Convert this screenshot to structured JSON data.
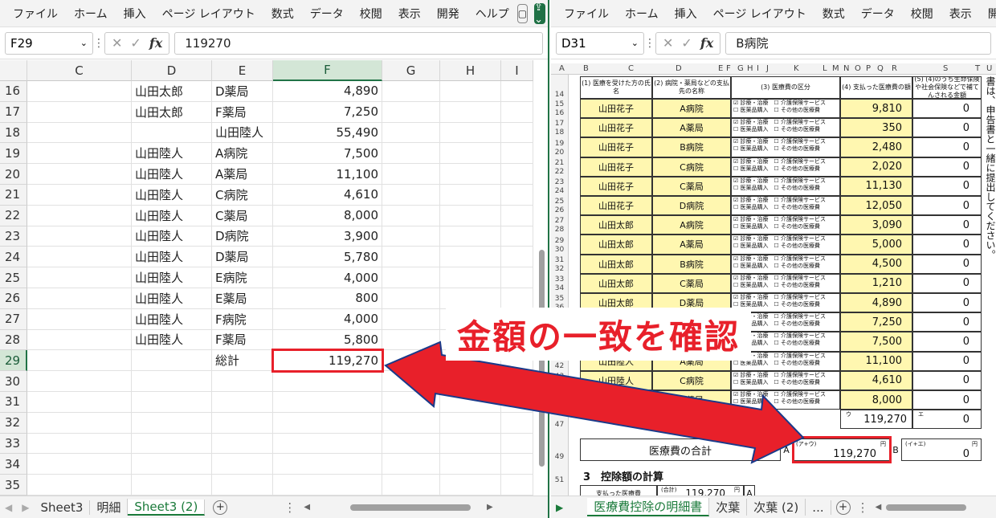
{
  "left": {
    "ribbon_tabs": [
      "ファイル",
      "ホーム",
      "挿入",
      "ページ レイアウト",
      "数式",
      "データ",
      "校閲",
      "表示",
      "開発",
      "ヘルプ"
    ],
    "comment_icon": "comment-icon",
    "share_icon": "share-icon",
    "namebox": "F29",
    "formula": "119270",
    "columns": [
      "C",
      "D",
      "E",
      "F",
      "G",
      "H",
      "I"
    ],
    "rows": [
      {
        "n": "16",
        "d": "山田太郎",
        "e": "D薬局",
        "f": "4,890"
      },
      {
        "n": "17",
        "d": "山田太郎",
        "e": "F薬局",
        "f": "7,250"
      },
      {
        "n": "18",
        "d": "",
        "e": "山田陸人",
        "f": "55,490"
      },
      {
        "n": "19",
        "d": "山田陸人",
        "e": "A病院",
        "f": "7,500"
      },
      {
        "n": "20",
        "d": "山田陸人",
        "e": "A薬局",
        "f": "11,100"
      },
      {
        "n": "21",
        "d": "山田陸人",
        "e": "C病院",
        "f": "4,610"
      },
      {
        "n": "22",
        "d": "山田陸人",
        "e": "C薬局",
        "f": "8,000"
      },
      {
        "n": "23",
        "d": "山田陸人",
        "e": "D病院",
        "f": "3,900"
      },
      {
        "n": "24",
        "d": "山田陸人",
        "e": "D薬局",
        "f": "5,780"
      },
      {
        "n": "25",
        "d": "山田陸人",
        "e": "E病院",
        "f": "4,000"
      },
      {
        "n": "26",
        "d": "山田陸人",
        "e": "E薬局",
        "f": "800"
      },
      {
        "n": "27",
        "d": "山田陸人",
        "e": "F病院",
        "f": "4,000"
      },
      {
        "n": "28",
        "d": "山田陸人",
        "e": "F薬局",
        "f": "5,800"
      },
      {
        "n": "29",
        "d": "",
        "e": "総計",
        "f": "119,270"
      },
      {
        "n": "30",
        "d": "",
        "e": "",
        "f": ""
      },
      {
        "n": "31",
        "d": "",
        "e": "",
        "f": ""
      },
      {
        "n": "32",
        "d": "",
        "e": "",
        "f": ""
      },
      {
        "n": "33",
        "d": "",
        "e": "",
        "f": ""
      },
      {
        "n": "34",
        "d": "",
        "e": "",
        "f": ""
      },
      {
        "n": "35",
        "d": "",
        "e": "",
        "f": ""
      }
    ],
    "sheet_tabs": [
      "Sheet3",
      "明細",
      "Sheet3 (2)"
    ]
  },
  "right": {
    "ribbon_tabs": [
      "ファイル",
      "ホーム",
      "挿入",
      "ページ レイアウト",
      "数式",
      "データ",
      "校閲",
      "表示",
      "開発",
      "ヘル"
    ],
    "namebox": "D31",
    "formula": "B病院",
    "columns": [
      "A",
      "B",
      "C",
      "D",
      "E",
      "F",
      "G",
      "H",
      "I",
      "J",
      "K",
      "L",
      "M",
      "N",
      "O",
      "P",
      "Q",
      "R",
      "S",
      "T",
      "U"
    ],
    "table_headers": [
      "(1) 医療を受けた方の氏名",
      "(2) 病院・薬局などの支払先の名称",
      "(3) 医療費の区分",
      "(4) 支払った医療費の額",
      "(5) (4)のうち生命保険や社会保険などで補てんされる金額"
    ],
    "category_labels": [
      "診療・治療",
      "介護保険サービス",
      "医薬品購入",
      "その他の医療費"
    ],
    "entries": [
      {
        "rows": "15\n16",
        "name": "山田花子",
        "place": "A病院",
        "amount": "9,810",
        "comp": "0",
        "unit": "円"
      },
      {
        "rows": "17\n18",
        "name": "山田花子",
        "place": "A薬局",
        "amount": "350",
        "comp": "0"
      },
      {
        "rows": "19\n20",
        "name": "山田花子",
        "place": "B病院",
        "amount": "2,480",
        "comp": "0"
      },
      {
        "rows": "21\n22",
        "name": "山田花子",
        "place": "C病院",
        "amount": "2,020",
        "comp": "0"
      },
      {
        "rows": "23\n24",
        "name": "山田花子",
        "place": "C薬局",
        "amount": "11,130",
        "comp": "0"
      },
      {
        "rows": "25\n26",
        "name": "山田花子",
        "place": "D病院",
        "amount": "12,050",
        "comp": "0"
      },
      {
        "rows": "27\n28",
        "name": "山田太郎",
        "place": "A病院",
        "amount": "3,090",
        "comp": "0"
      },
      {
        "rows": "29\n30",
        "name": "山田太郎",
        "place": "A薬局",
        "amount": "5,000",
        "comp": "0"
      },
      {
        "rows": "31\n32",
        "name": "山田太郎",
        "place": "B病院",
        "amount": "4,500",
        "comp": "0"
      },
      {
        "rows": "33\n34",
        "name": "山田太郎",
        "place": "C薬局",
        "amount": "1,210",
        "comp": "0"
      },
      {
        "rows": "35\n36",
        "name": "山田太郎",
        "place": "D薬局",
        "amount": "4,890",
        "comp": "0"
      },
      {
        "rows": "37\n38",
        "name": "",
        "place": "",
        "amount": "7,250",
        "comp": "0"
      },
      {
        "rows": "39\n40",
        "name": "",
        "place": "",
        "amount": "7,500",
        "comp": "0"
      },
      {
        "rows": "41\n42",
        "name": "山田陸人",
        "place": "A薬局",
        "amount": "11,100",
        "comp": "0"
      },
      {
        "rows": "43\n44",
        "name": "山田陸人",
        "place": "C病院",
        "amount": "4,610",
        "comp": "0"
      },
      {
        "rows": "45\n46",
        "name": "",
        "place": "C薬局",
        "amount": "8,000",
        "comp": "0"
      }
    ],
    "subtotal_mark": "ウ",
    "subtotal": "119,270",
    "subtotal_comp_mark": "エ",
    "subtotal_comp": "0",
    "total_label": "医療費の合計",
    "total_a": "A",
    "total_mark": "(ア+ウ)",
    "total_unit": "円",
    "total_value": "119,270",
    "total_b": "B",
    "total_b_mark": "(イ+エ)",
    "total_b_unit": "円",
    "total_b_value": "0",
    "section3": "3　控除額の計算",
    "calc_label": "支払った医療費",
    "calc_mark": "(合計)",
    "calc_value": "119,270",
    "calc_unit": "円",
    "calc_a": "A",
    "side_text": "書は、申告書と一緒に提出してください。",
    "sheet_tabs": [
      "医療費控除の明細書",
      "次葉",
      "次葉 (2)",
      "..."
    ]
  },
  "callout": "金額の一致を確認",
  "accent": "#e8202a",
  "excel_green": "#217346"
}
